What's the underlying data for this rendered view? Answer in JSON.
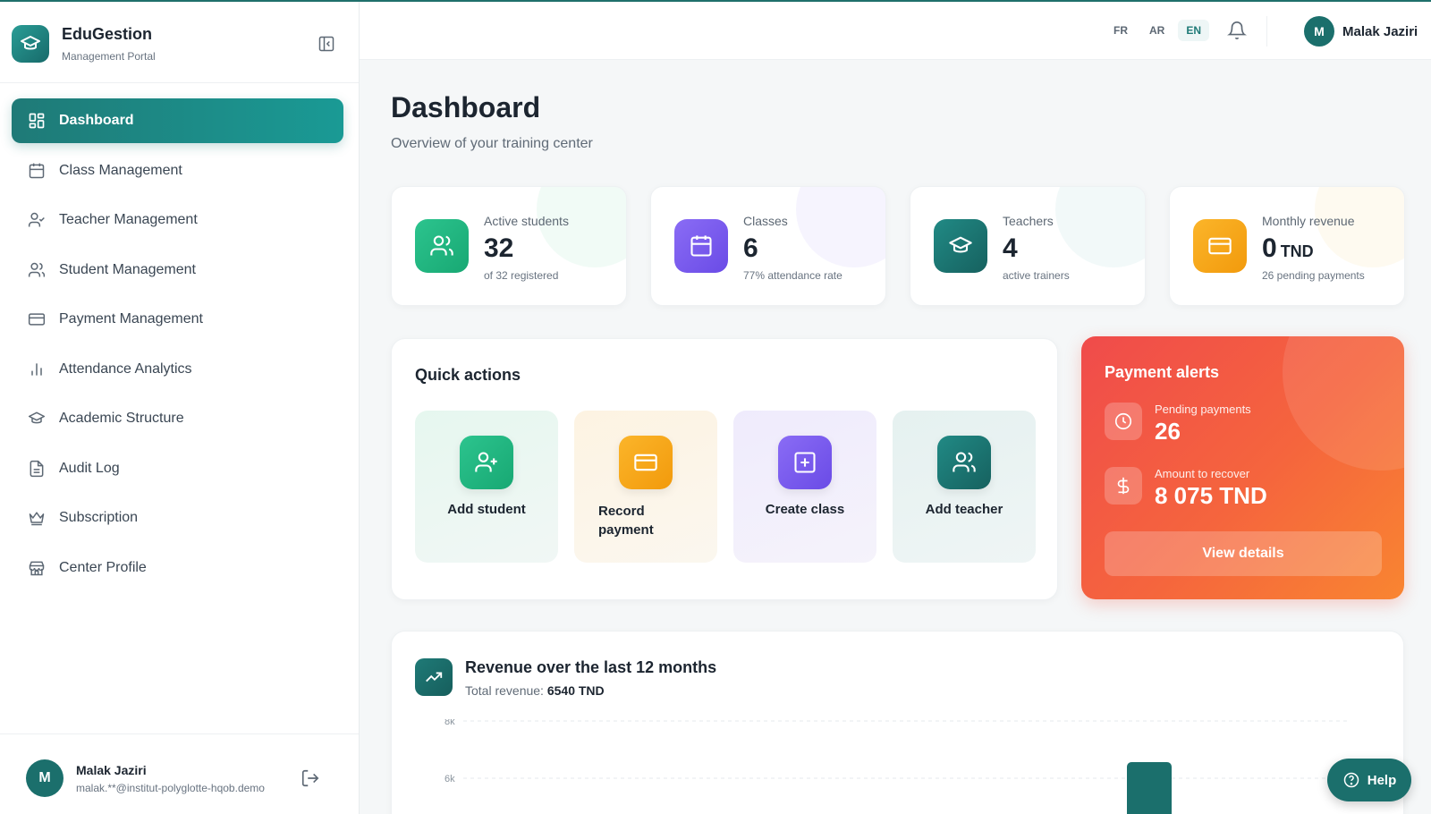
{
  "brand": {
    "name": "EduGestion",
    "subtitle": "Management Portal"
  },
  "sidebar": {
    "items": [
      {
        "label": "Dashboard",
        "icon": "grid-icon",
        "active": true
      },
      {
        "label": "Class Management",
        "icon": "calendar-icon"
      },
      {
        "label": "Teacher Management",
        "icon": "user-check-icon"
      },
      {
        "label": "Student Management",
        "icon": "users-icon"
      },
      {
        "label": "Payment Management",
        "icon": "credit-card-icon"
      },
      {
        "label": "Attendance Analytics",
        "icon": "bar-chart-icon"
      },
      {
        "label": "Academic Structure",
        "icon": "graduation-cap-icon"
      },
      {
        "label": "Audit Log",
        "icon": "file-text-icon"
      },
      {
        "label": "Subscription",
        "icon": "crown-icon"
      },
      {
        "label": "Center Profile",
        "icon": "store-icon"
      }
    ],
    "footer": {
      "initial": "M",
      "name": "Malak Jaziri",
      "email": "malak.**@institut-polyglotte-hqob.demo"
    }
  },
  "topbar": {
    "languages": [
      "FR",
      "AR",
      "EN"
    ],
    "active_language": "EN",
    "user": {
      "initial": "M",
      "name": "Malak Jaziri"
    }
  },
  "page": {
    "title": "Dashboard",
    "subtitle": "Overview of your training center"
  },
  "stats": [
    {
      "label": "Active students",
      "value": "32",
      "unit": "",
      "note": "of 32 registered",
      "color": "#1fb57f"
    },
    {
      "label": "Classes",
      "value": "6",
      "unit": "",
      "note": "77% attendance rate",
      "color": "#7b5cf0"
    },
    {
      "label": "Teachers",
      "value": "4",
      "unit": "",
      "note": "active trainers",
      "color": "#1b7a76"
    },
    {
      "label": "Monthly revenue",
      "value": "0",
      "unit": "TND",
      "note": "26 pending payments",
      "color": "#f7a60f"
    }
  ],
  "quick_actions": {
    "title": "Quick actions",
    "items": [
      {
        "label": "Add student",
        "icon": "user-plus-icon"
      },
      {
        "label": "Record payment",
        "icon": "credit-card-icon"
      },
      {
        "label": "Create class",
        "icon": "plus-square-icon"
      },
      {
        "label": "Add teacher",
        "icon": "users-icon"
      }
    ]
  },
  "payment_alerts": {
    "title": "Payment alerts",
    "pending_label": "Pending payments",
    "pending_value": "26",
    "recover_label": "Amount to recover",
    "recover_value": "8 075 TND",
    "button": "View details"
  },
  "revenue": {
    "title": "Revenue over the last 12 months",
    "total_label": "Total revenue:",
    "total_value": "6540 TND"
  },
  "chart_data": {
    "type": "bar",
    "title": "Revenue over the last 12 months",
    "y_ticks": [
      "8k",
      "6k"
    ],
    "ylim_visible": [
      6000,
      8000
    ],
    "grid": true,
    "visible_bar_note": "a bar rises above 6k at roughly the 10th of 12 months; lower portion of chart is cropped",
    "bar_color": "#1b6f6c"
  },
  "help": {
    "label": "Help"
  },
  "colors": {
    "accent": "#1f7a77",
    "alert": "#f2553f"
  }
}
